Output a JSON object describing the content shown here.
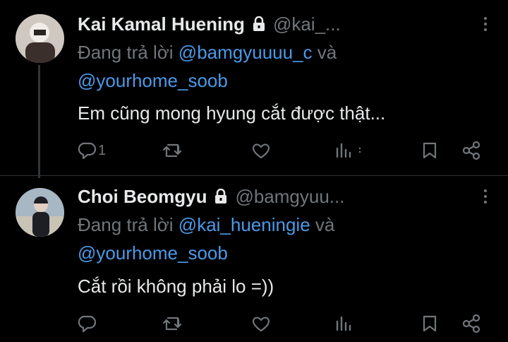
{
  "tweets": [
    {
      "display_name": "Kai Kamal Huening",
      "handle": "@kai_...",
      "replying_prefix": "Đang trả lời",
      "mention_1": "@bamgyuuuu_c",
      "conjunction": "và",
      "mention_2": "@yourhome_soob",
      "text": "Em cũng mong hyung cắt được thật...",
      "reply_count": "1",
      "avatar_colors": [
        "#d9d4cf",
        "#3a2f2a"
      ]
    },
    {
      "display_name": "Choi Beomgyu",
      "handle": "@bamgyuu...",
      "replying_prefix": "Đang trả lời",
      "mention_1": "@kai_hueningie",
      "conjunction": "và",
      "mention_2": "@yourhome_soob",
      "text": "Cắt rồi không phải lo =))",
      "reply_count": "",
      "avatar_colors": [
        "#9fb1c0",
        "#1d1f24"
      ]
    }
  ],
  "icons": {
    "lock": "lock-icon",
    "reply": "reply-icon",
    "retweet": "retweet-icon",
    "like": "heart-icon",
    "views": "bar-chart-icon",
    "bookmark": "bookmark-icon",
    "share": "share-icon",
    "more": "more-icon"
  },
  "colors": {
    "background": "#000000",
    "text": "#e7e9ea",
    "muted": "#71767b",
    "mention": "#4b99e8"
  }
}
